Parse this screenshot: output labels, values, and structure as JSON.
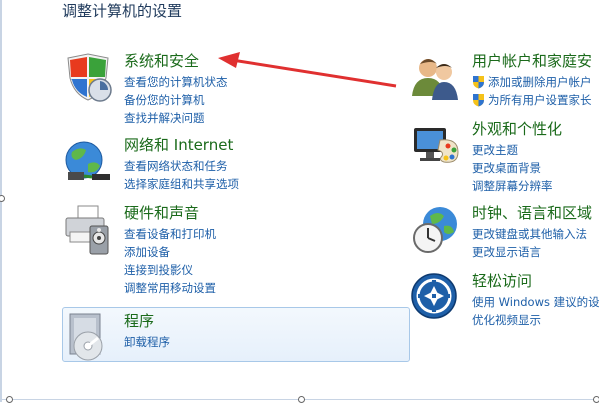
{
  "header": {
    "title": "调整计算机的设置"
  },
  "left_column": [
    {
      "title": "系统和安全",
      "icon": "shield-icon",
      "links": [
        "查看您的计算机状态",
        "备份您的计算机",
        "查找并解决问题"
      ]
    },
    {
      "title": "网络和 Internet",
      "icon": "network-globe-icon",
      "links": [
        "查看网络状态和任务",
        "选择家庭组和共享选项"
      ]
    },
    {
      "title": "硬件和声音",
      "icon": "printer-speaker-icon",
      "links": [
        "查看设备和打印机",
        "添加设备",
        "连接到投影仪",
        "调整常用移动设置"
      ]
    },
    {
      "title": "程序",
      "icon": "programs-disc-icon",
      "links": [
        "卸载程序"
      ]
    }
  ],
  "right_column": [
    {
      "title": "用户帐户和家庭安",
      "icon": "users-icon",
      "links": [
        "添加或删除用户帐户",
        "为所有用户设置家长"
      ]
    },
    {
      "title": "外观和个性化",
      "icon": "monitor-palette-icon",
      "links": [
        "更改主题",
        "更改桌面背景",
        "调整屏幕分辨率"
      ]
    },
    {
      "title": "时钟、语言和区域",
      "icon": "clock-globe-icon",
      "links": [
        "更改键盘或其他输入法",
        "更改显示语言"
      ]
    },
    {
      "title": "轻松访问",
      "icon": "ease-of-access-icon",
      "links": [
        "使用 Windows 建议的设",
        "优化视频显示"
      ]
    }
  ],
  "annotation": {
    "color": "#e03030"
  },
  "colors": {
    "title_green": "#1a6a1a",
    "link_blue": "#1e5fa8",
    "header": "#1e395b"
  }
}
